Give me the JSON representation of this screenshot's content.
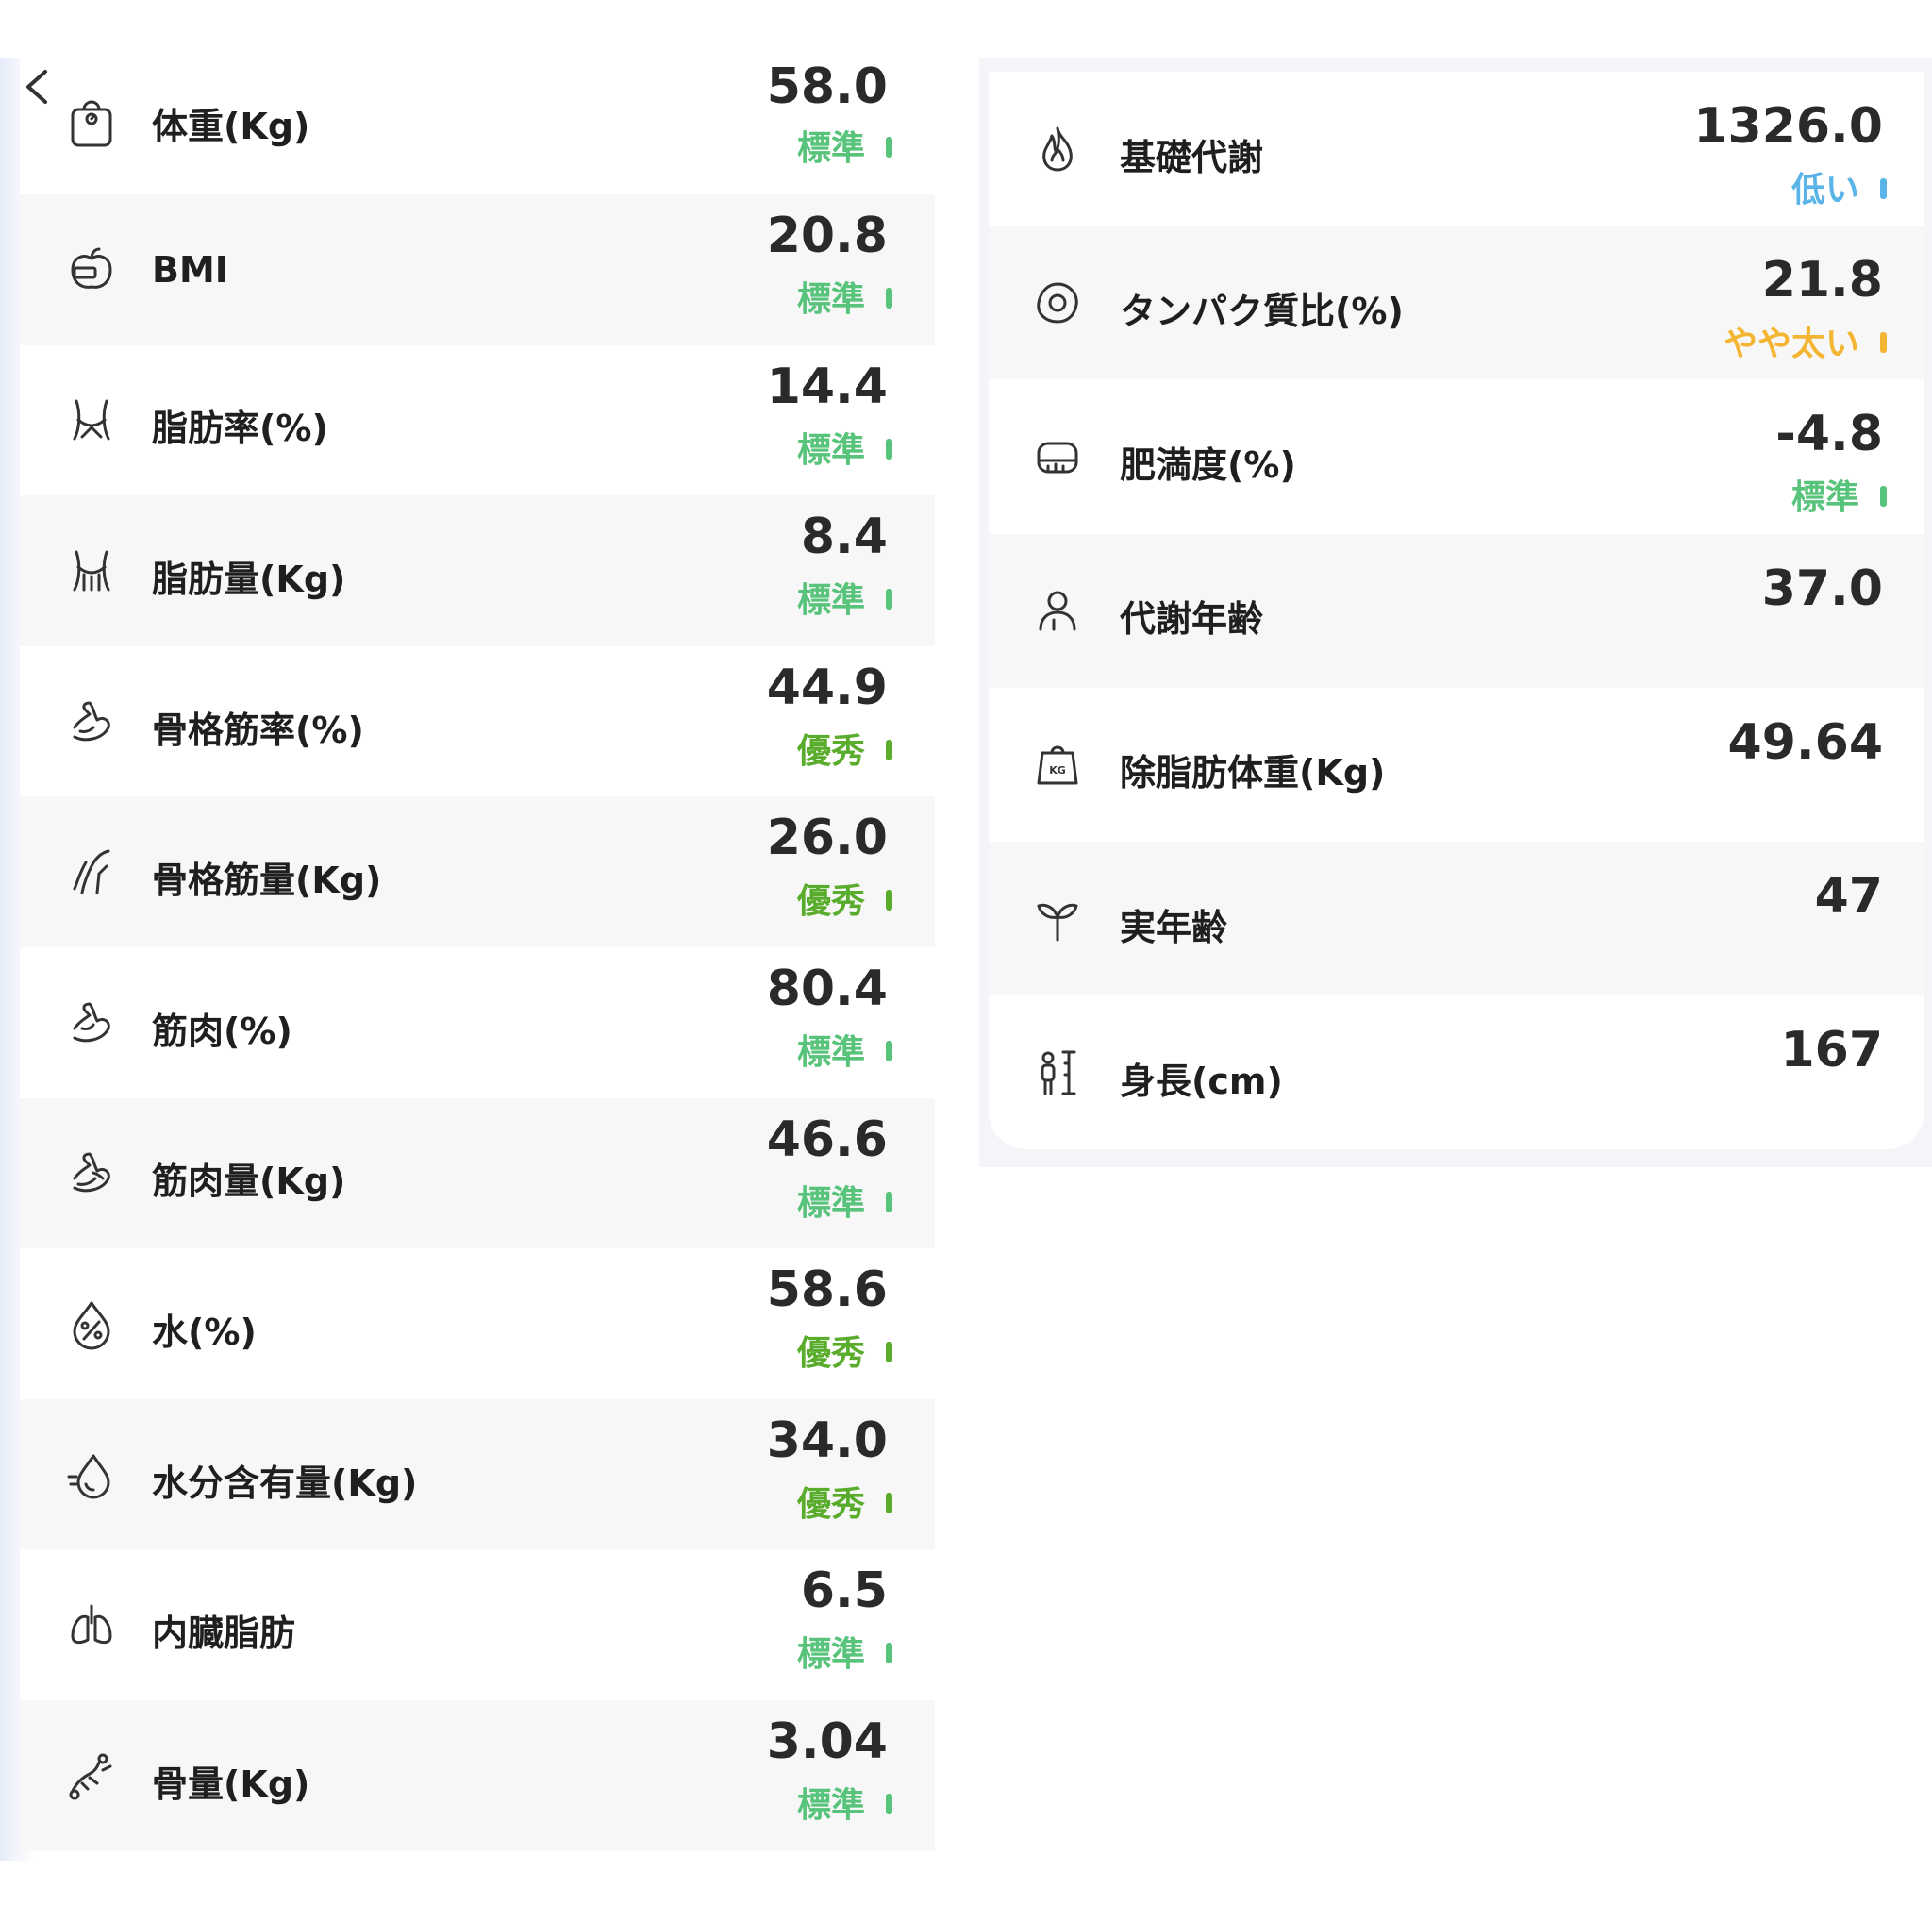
{
  "colors": {
    "standard": "#58c37a",
    "excellent": "#5aad2c",
    "low": "#5ab4e8",
    "slightly_high": "#f4b632"
  },
  "left_metrics": [
    {
      "label": "体重(Kg)",
      "value": "58.0",
      "status": "標準",
      "level": "standard",
      "icon": "scale-icon"
    },
    {
      "label": "BMI",
      "value": "20.8",
      "status": "標準",
      "level": "standard",
      "icon": "apple-tape-icon"
    },
    {
      "label": "脂肪率(%)",
      "value": "14.4",
      "status": "標準",
      "level": "standard",
      "icon": "waist-icon"
    },
    {
      "label": "脂肪量(Kg)",
      "value": "8.4",
      "status": "標準",
      "level": "standard",
      "icon": "waist-fat-icon"
    },
    {
      "label": "骨格筋率(%)",
      "value": "44.9",
      "status": "優秀",
      "level": "excellent",
      "icon": "arm-muscle-icon"
    },
    {
      "label": "骨格筋量(Kg)",
      "value": "26.0",
      "status": "優秀",
      "level": "excellent",
      "icon": "leg-muscle-icon"
    },
    {
      "label": "筋肉(%)",
      "value": "80.4",
      "status": "標準",
      "level": "standard",
      "icon": "biceps-icon"
    },
    {
      "label": "筋肉量(Kg)",
      "value": "46.6",
      "status": "標準",
      "level": "standard",
      "icon": "biceps-flex-icon"
    },
    {
      "label": "水(%)",
      "value": "58.6",
      "status": "優秀",
      "level": "excellent",
      "icon": "water-percent-icon"
    },
    {
      "label": "水分含有量(Kg)",
      "value": "34.0",
      "status": "優秀",
      "level": "excellent",
      "icon": "water-drop-icon"
    },
    {
      "label": "内臓脂肪",
      "value": "6.5",
      "status": "標準",
      "level": "standard",
      "icon": "lungs-icon"
    },
    {
      "label": "骨量(Kg)",
      "value": "3.04",
      "status": "標準",
      "level": "standard",
      "icon": "bone-icon"
    }
  ],
  "right_metrics": [
    {
      "label": "基礎代謝",
      "value": "1326.0",
      "status": "低い",
      "level": "low",
      "icon": "flame-icon"
    },
    {
      "label": "タンパク質比(%)",
      "value": "21.8",
      "status": "やや太い",
      "level": "slightly_high",
      "icon": "egg-icon"
    },
    {
      "label": "肥満度(%)",
      "value": "-4.8",
      "status": "標準",
      "level": "standard",
      "icon": "tape-measure-icon"
    },
    {
      "label": "代謝年齢",
      "value": "37.0",
      "status": "",
      "level": "",
      "icon": "person-icon"
    },
    {
      "label": "除脂肪体重(Kg)",
      "value": "49.64",
      "status": "",
      "level": "",
      "icon": "kg-weight-icon"
    },
    {
      "label": "実年齢",
      "value": "47",
      "status": "",
      "level": "",
      "icon": "sprout-icon"
    },
    {
      "label": "身長(cm)",
      "value": "167",
      "status": "",
      "level": "",
      "icon": "height-icon"
    }
  ]
}
